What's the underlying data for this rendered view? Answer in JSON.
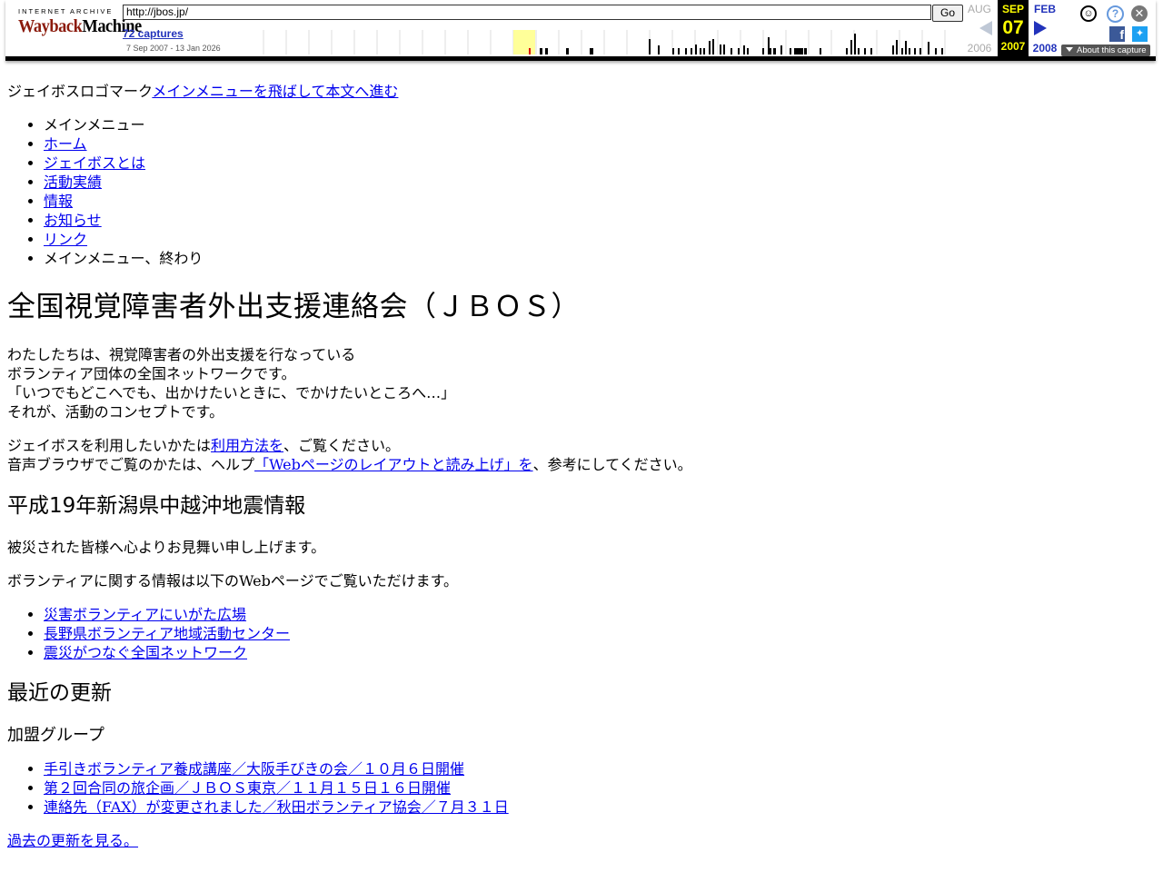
{
  "wayback": {
    "logo_top": "INTERNET ARCHIVE",
    "logo_wayback": "WaybackMachine",
    "url": "http://jbos.jp/",
    "go_label": "Go",
    "captures_label": "72 captures",
    "range_label": "7 Sep 2007 - 13 Jan 2026",
    "prev_month": "AUG",
    "prev_year": "2006",
    "current_month": "SEP",
    "current_day": "07",
    "current_year": "2007",
    "next_month": "FEB",
    "next_year": "2008",
    "about_label": "About this capture"
  },
  "header": {
    "logo_alt": "ジェイボスロゴマーク",
    "skip_link": "メインメニューを飛ばして本文へ進む"
  },
  "menu": {
    "start": "メインメニュー",
    "items": [
      "ホーム",
      "ジェイボスとは",
      "活動実績",
      "情報",
      "お知らせ",
      "リンク"
    ],
    "end": "メインメニュー、終わり"
  },
  "main": {
    "title": "全国視覚障害者外出支援連絡会（ＪＢＯＳ）",
    "intro_lines": [
      "わたしたちは、視覚障害者の外出支援を行なっている",
      "ボランティア団体の全国ネットワークです。",
      "「いつでもどこへでも、出かけたいときに、でかけたいところへ…」",
      "それが、活動のコンセプトです。"
    ],
    "usage_prefix": "ジェイボスを利用したいかたは",
    "usage_link": "利用方法を",
    "usage_suffix": "、ご覧ください。",
    "help_prefix": "音声ブラウザでご覧のかたは、ヘルプ",
    "help_link": "「Webページのレイアウトと読み上げ」を",
    "help_suffix": "、参考にしてください。"
  },
  "quake": {
    "heading": "平成19年新潟県中越沖地震情報",
    "p1": "被災された皆様へ心よりお見舞い申し上げます。",
    "p2": "ボランティアに関する情報は以下のWebページでご覧いただけます。",
    "links": [
      "災害ボランティアにいがた広場",
      "長野県ボランティア地域活動センター",
      "震災がつなぐ全国ネットワーク"
    ]
  },
  "updates": {
    "heading": "最近の更新",
    "group_heading": "加盟グループ",
    "links": [
      "手引きボランティア養成講座／大阪手びきの会／１０月６日開催",
      "第２回合同の旅企画／ＪＢＯＳ東京／１１月１５日１６日開催",
      "連絡先（FAX）が変更されました／秋田ボランティア協会／７月３１日"
    ],
    "past_link": "過去の更新を見る。"
  },
  "colors": {
    "link": "#0000ee",
    "wayback_logo_red": "#8b1a0b",
    "wayback_blue": "#2233bb",
    "current_capture_yellow": "#ffff00"
  }
}
